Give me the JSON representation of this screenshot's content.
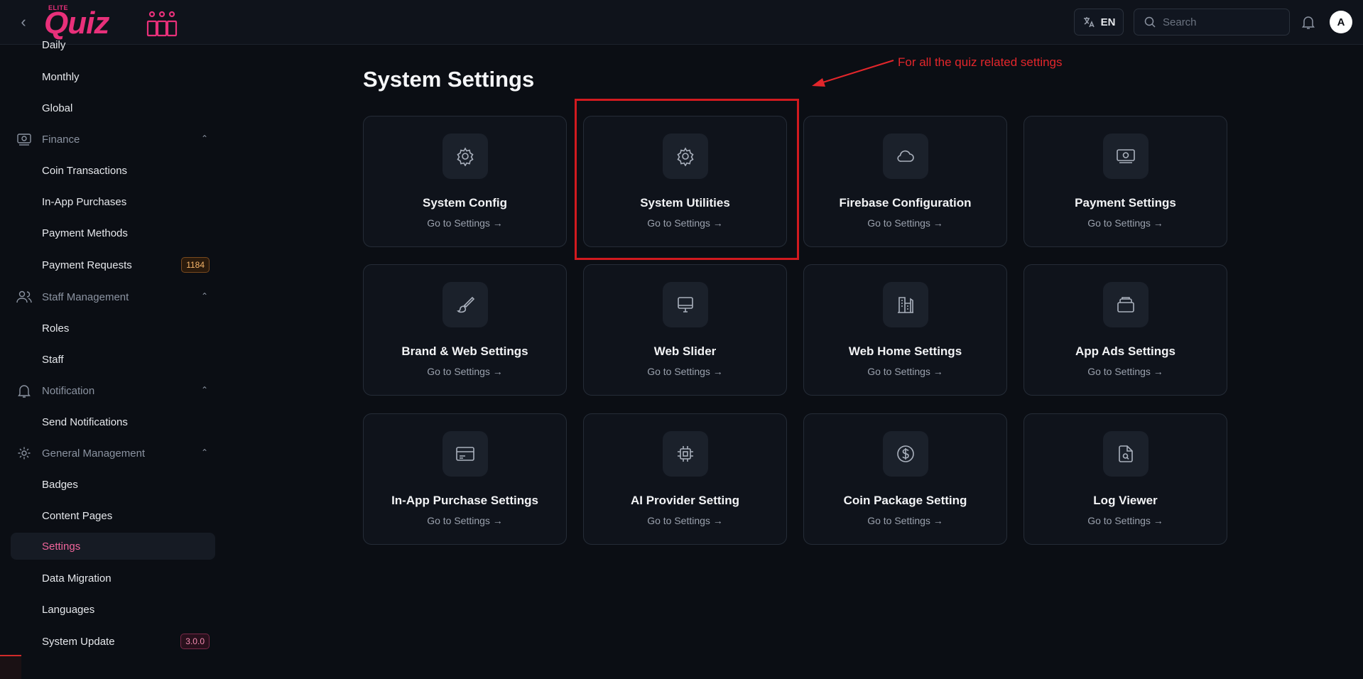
{
  "header": {
    "logo_small": "ELITE",
    "logo_text": "Quiz",
    "language": "EN",
    "search_placeholder": "Search",
    "avatar_initial": "A"
  },
  "sidebar": {
    "items": [
      {
        "label": "Daily",
        "type": "sub"
      },
      {
        "label": "Monthly",
        "type": "sub"
      },
      {
        "label": "Global",
        "type": "sub"
      },
      {
        "label": "Finance",
        "type": "group",
        "icon": "money-icon"
      },
      {
        "label": "Coin Transactions",
        "type": "sub"
      },
      {
        "label": "In-App Purchases",
        "type": "sub"
      },
      {
        "label": "Payment Methods",
        "type": "sub"
      },
      {
        "label": "Payment Requests",
        "type": "sub",
        "badge": "1184"
      },
      {
        "label": "Staff Management",
        "type": "group",
        "icon": "users-icon"
      },
      {
        "label": "Roles",
        "type": "sub"
      },
      {
        "label": "Staff",
        "type": "sub"
      },
      {
        "label": "Notification",
        "type": "group",
        "icon": "bell-icon"
      },
      {
        "label": "Send Notifications",
        "type": "sub"
      },
      {
        "label": "General Management",
        "type": "group",
        "icon": "gear-icon"
      },
      {
        "label": "Badges",
        "type": "sub"
      },
      {
        "label": "Content Pages",
        "type": "sub"
      },
      {
        "label": "Settings",
        "type": "sub",
        "active": true
      },
      {
        "label": "Data Migration",
        "type": "sub"
      },
      {
        "label": "Languages",
        "type": "sub"
      },
      {
        "label": "System Update",
        "type": "sub",
        "badge": "3.0.0"
      }
    ]
  },
  "main": {
    "title": "System Settings",
    "annotation": "For all the quiz related settings",
    "link_label": "Go to Settings →",
    "cards": [
      {
        "title": "System Config",
        "icon": "gear-icon"
      },
      {
        "title": "System Utilities",
        "icon": "gear-icon"
      },
      {
        "title": "Firebase Configuration",
        "icon": "cloud-icon"
      },
      {
        "title": "Payment Settings",
        "icon": "money-icon"
      },
      {
        "title": "Brand & Web Settings",
        "icon": "brush-icon"
      },
      {
        "title": "Web Slider",
        "icon": "monitor-icon"
      },
      {
        "title": "Web Home Settings",
        "icon": "building-icon"
      },
      {
        "title": "App Ads Settings",
        "icon": "stack-icon"
      },
      {
        "title": "In-App Purchase Settings",
        "icon": "credit-card-icon"
      },
      {
        "title": "AI Provider Setting",
        "icon": "cpu-icon"
      },
      {
        "title": "Coin Package Setting",
        "icon": "dollar-coin-icon"
      },
      {
        "title": "Log Viewer",
        "icon": "file-search-icon"
      }
    ]
  },
  "colors": {
    "accent": "#e8307a",
    "annotation_red": "#e3262b",
    "background": "#0b0e14",
    "card": "#0f131b"
  }
}
